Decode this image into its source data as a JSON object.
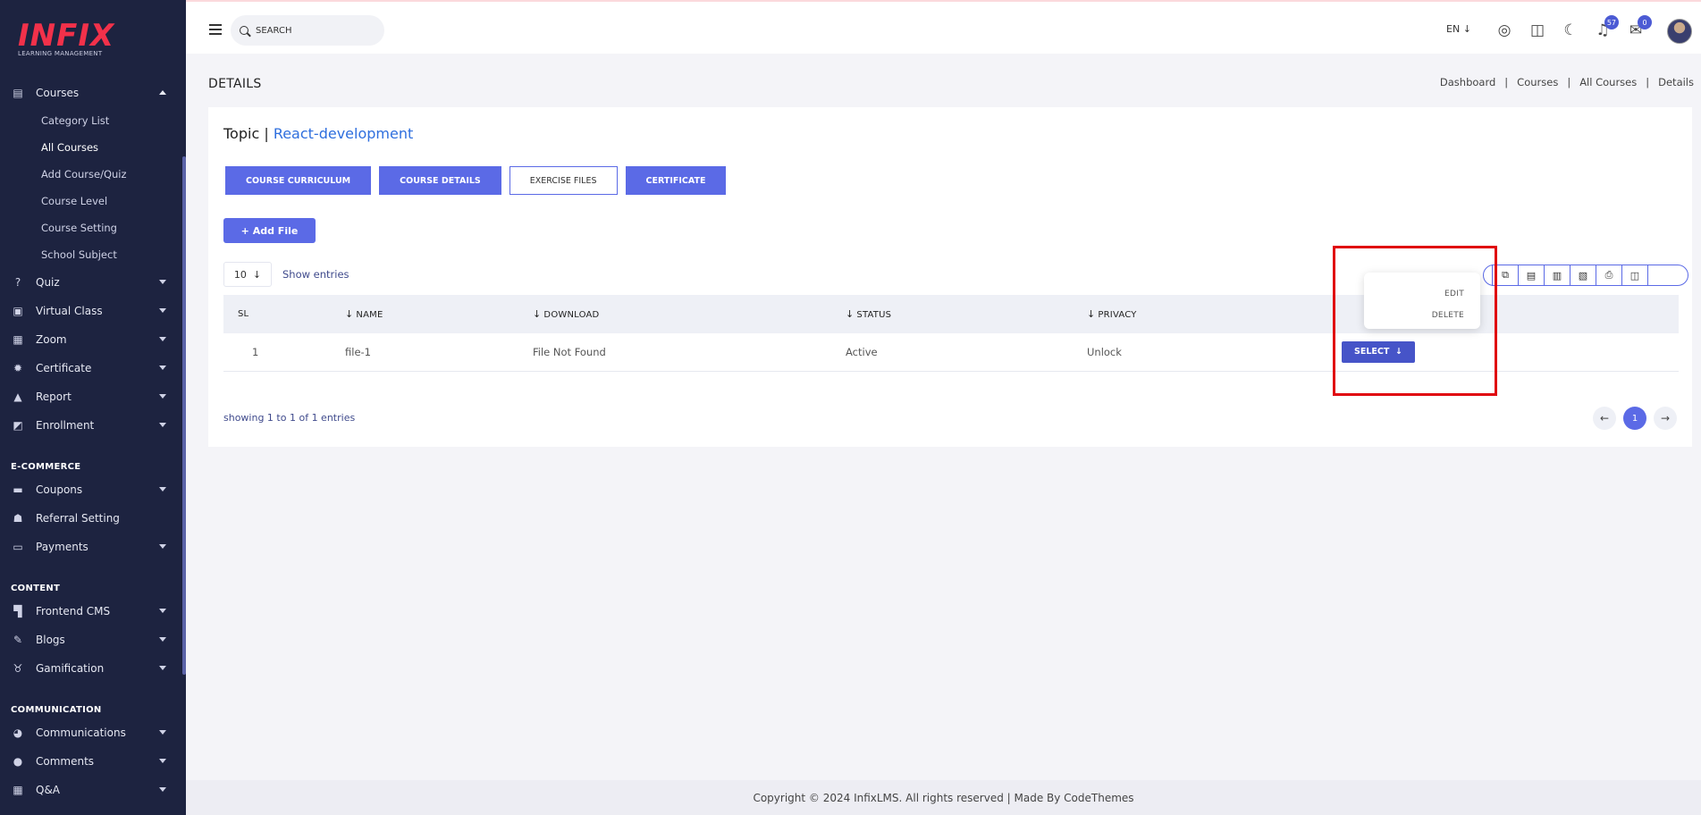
{
  "app": {
    "logo_text": "INFIX",
    "logo_sub": "LEARNING MANAGEMENT"
  },
  "sidebar": {
    "courses": {
      "label": "Courses",
      "icon": "book-icon"
    },
    "course_subitems": [
      "Category List",
      "All Courses",
      "Add Course/Quiz",
      "Course Level",
      "Course Setting",
      "School Subject"
    ],
    "items": [
      {
        "label": "Quiz",
        "icon": "question-circle-icon"
      },
      {
        "label": "Virtual Class",
        "icon": "video-icon"
      },
      {
        "label": "Zoom",
        "icon": "grid-icon"
      },
      {
        "label": "Certificate",
        "icon": "badge-icon"
      },
      {
        "label": "Report",
        "icon": "chart-icon"
      },
      {
        "label": "Enrollment",
        "icon": "enrollment-icon"
      }
    ],
    "section_ecommerce": "E-COMMERCE",
    "ecommerce_items": [
      {
        "label": "Coupons",
        "icon": "coupon-icon"
      },
      {
        "label": "Referral Setting",
        "icon": "users-icon"
      },
      {
        "label": "Payments",
        "icon": "money-icon"
      }
    ],
    "section_content": "CONTENT",
    "content_items": [
      {
        "label": "Frontend CMS",
        "icon": "paint-roller-icon"
      },
      {
        "label": "Blogs",
        "icon": "edit-icon"
      },
      {
        "label": "Gamification",
        "icon": "medal-icon"
      }
    ],
    "section_communication": "COMMUNICATION",
    "communication_items": [
      {
        "label": "Communications",
        "icon": "chat-bubbles-icon"
      },
      {
        "label": "Comments",
        "icon": "comment-icon"
      },
      {
        "label": "Q&A",
        "icon": "grid-icon"
      }
    ]
  },
  "topbar": {
    "search_placeholder": "SEARCH",
    "language": "EN",
    "notifications_count": "57",
    "messages_count": "0"
  },
  "page": {
    "title": "DETAILS",
    "breadcrumb": [
      "Dashboard",
      "Courses",
      "All Courses",
      "Details"
    ]
  },
  "card": {
    "topic_label": "Topic |",
    "topic_name": "React-development",
    "tabs": [
      "COURSE CURRICULUM",
      "COURSE DETAILS",
      "EXERCISE FILES",
      "CERTIFICATE"
    ],
    "add_file": "+ Add File",
    "entries_value": "10",
    "entries_label": "Show entries",
    "columns": [
      "SL",
      "NAME",
      "DOWNLOAD",
      "STATUS",
      "PRIVACY"
    ],
    "rows": [
      {
        "sl": "1",
        "name": "file-1",
        "download": "File Not Found",
        "status": "Active",
        "privacy": "Unlock",
        "action": "SELECT"
      }
    ],
    "dropdown": [
      "EDIT",
      "DELETE"
    ],
    "showing": "showing 1 to 1 of 1 entries",
    "current_page": "1"
  },
  "footer": {
    "text": "Copyright © 2024 InfixLMS. All rights reserved | Made By CodeThemes"
  },
  "colors": {
    "sidebar_bg": "#1d2340",
    "accent": "#5b6ae6",
    "highlight": "#e0060f",
    "logo": "#f2314a"
  }
}
